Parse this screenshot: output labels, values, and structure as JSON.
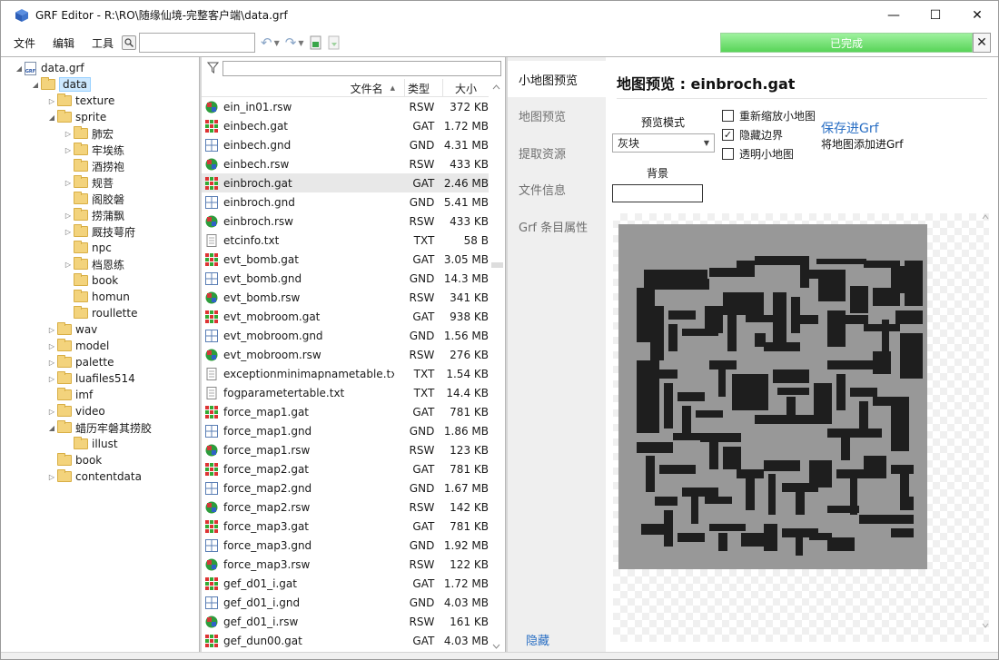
{
  "window": {
    "title": "GRF Editor - R:\\RO\\随缘仙境-完整客户端\\data.grf",
    "minimize_glyph": "—",
    "maximize_glyph": "☐",
    "close_glyph": "✕"
  },
  "menu": {
    "file": "文件",
    "edit": "编辑",
    "tools": "工具"
  },
  "toolbar": {
    "search_value": "",
    "undo_glyph": "↶",
    "redo_glyph": "↷",
    "progress_label": "已完成",
    "progress_fraction": 1.0,
    "progress_close": "✕"
  },
  "tree": {
    "root": "data.grf",
    "items": [
      {
        "label": "data",
        "depth": 1,
        "expanded": true,
        "selected": true
      },
      {
        "label": "texture",
        "depth": 2,
        "expanded": false
      },
      {
        "label": "sprite",
        "depth": 2,
        "expanded": true
      },
      {
        "label": "肺宏",
        "depth": 3,
        "expanded": false
      },
      {
        "label": "牢埃练",
        "depth": 3,
        "expanded": false
      },
      {
        "label": "酒捞袍",
        "depth": 3,
        "expanded": null
      },
      {
        "label": "规菩",
        "depth": 3,
        "expanded": false
      },
      {
        "label": "阁胶磐",
        "depth": 3,
        "expanded": null
      },
      {
        "label": "捞蒲飘",
        "depth": 3,
        "expanded": false
      },
      {
        "label": "厩技萼府",
        "depth": 3,
        "expanded": false
      },
      {
        "label": "npc",
        "depth": 3,
        "expanded": null
      },
      {
        "label": "档恩练",
        "depth": 3,
        "expanded": false
      },
      {
        "label": "book",
        "depth": 3,
        "expanded": null
      },
      {
        "label": "homun",
        "depth": 3,
        "expanded": null
      },
      {
        "label": "roullette",
        "depth": 3,
        "expanded": null
      },
      {
        "label": "wav",
        "depth": 2,
        "expanded": false
      },
      {
        "label": "model",
        "depth": 2,
        "expanded": false
      },
      {
        "label": "palette",
        "depth": 2,
        "expanded": false
      },
      {
        "label": "luafiles514",
        "depth": 2,
        "expanded": false
      },
      {
        "label": "imf",
        "depth": 2,
        "expanded": null
      },
      {
        "label": "video",
        "depth": 2,
        "expanded": false
      },
      {
        "label": "蜡历牢磐其捞胶",
        "depth": 2,
        "expanded": true
      },
      {
        "label": "illust",
        "depth": 3,
        "expanded": null
      },
      {
        "label": "book",
        "depth": 2,
        "expanded": null
      },
      {
        "label": "contentdata",
        "depth": 2,
        "expanded": false
      }
    ]
  },
  "filelist": {
    "filter_value": "",
    "columns": {
      "name": "文件名",
      "type": "类型",
      "size": "大小"
    },
    "rows": [
      {
        "name": "ein_in01.rsw",
        "type": "RSW",
        "size": "372 KB",
        "kind": "rsw"
      },
      {
        "name": "einbech.gat",
        "type": "GAT",
        "size": "1.72 MB",
        "kind": "gat"
      },
      {
        "name": "einbech.gnd",
        "type": "GND",
        "size": "4.31 MB",
        "kind": "gnd"
      },
      {
        "name": "einbech.rsw",
        "type": "RSW",
        "size": "433 KB",
        "kind": "rsw"
      },
      {
        "name": "einbroch.gat",
        "type": "GAT",
        "size": "2.46 MB",
        "kind": "gat",
        "selected": true
      },
      {
        "name": "einbroch.gnd",
        "type": "GND",
        "size": "5.41 MB",
        "kind": "gnd"
      },
      {
        "name": "einbroch.rsw",
        "type": "RSW",
        "size": "433 KB",
        "kind": "rsw"
      },
      {
        "name": "etcinfo.txt",
        "type": "TXT",
        "size": "58 B",
        "kind": "txt"
      },
      {
        "name": "evt_bomb.gat",
        "type": "GAT",
        "size": "3.05 MB",
        "kind": "gat"
      },
      {
        "name": "evt_bomb.gnd",
        "type": "GND",
        "size": "14.3 MB",
        "kind": "gnd"
      },
      {
        "name": "evt_bomb.rsw",
        "type": "RSW",
        "size": "341 KB",
        "kind": "rsw"
      },
      {
        "name": "evt_mobroom.gat",
        "type": "GAT",
        "size": "938 KB",
        "kind": "gat"
      },
      {
        "name": "evt_mobroom.gnd",
        "type": "GND",
        "size": "1.56 MB",
        "kind": "gnd"
      },
      {
        "name": "evt_mobroom.rsw",
        "type": "RSW",
        "size": "276 KB",
        "kind": "rsw"
      },
      {
        "name": "exceptionminimapnametable.txt",
        "type": "TXT",
        "size": "1.54 KB",
        "kind": "txt"
      },
      {
        "name": "fogparametertable.txt",
        "type": "TXT",
        "size": "14.4 KB",
        "kind": "txt"
      },
      {
        "name": "force_map1.gat",
        "type": "GAT",
        "size": "781 KB",
        "kind": "gat"
      },
      {
        "name": "force_map1.gnd",
        "type": "GND",
        "size": "1.86 MB",
        "kind": "gnd"
      },
      {
        "name": "force_map1.rsw",
        "type": "RSW",
        "size": "123 KB",
        "kind": "rsw"
      },
      {
        "name": "force_map2.gat",
        "type": "GAT",
        "size": "781 KB",
        "kind": "gat"
      },
      {
        "name": "force_map2.gnd",
        "type": "GND",
        "size": "1.67 MB",
        "kind": "gnd"
      },
      {
        "name": "force_map2.rsw",
        "type": "RSW",
        "size": "142 KB",
        "kind": "rsw"
      },
      {
        "name": "force_map3.gat",
        "type": "GAT",
        "size": "781 KB",
        "kind": "gat"
      },
      {
        "name": "force_map3.gnd",
        "type": "GND",
        "size": "1.92 MB",
        "kind": "gnd"
      },
      {
        "name": "force_map3.rsw",
        "type": "RSW",
        "size": "122 KB",
        "kind": "rsw"
      },
      {
        "name": "gef_d01_i.gat",
        "type": "GAT",
        "size": "1.72 MB",
        "kind": "gat"
      },
      {
        "name": "gef_d01_i.gnd",
        "type": "GND",
        "size": "4.03 MB",
        "kind": "gnd"
      },
      {
        "name": "gef_d01_i.rsw",
        "type": "RSW",
        "size": "161 KB",
        "kind": "rsw"
      },
      {
        "name": "gef_dun00.gat",
        "type": "GAT",
        "size": "4.03 MB",
        "kind": "gat"
      }
    ]
  },
  "tabs": {
    "items": [
      "小地图预览",
      "地图预览",
      "提取资源",
      "文件信息",
      "Grf 条目属性"
    ],
    "active": 0,
    "hide_link": "隐藏"
  },
  "minimap": {
    "title": "地图预览 : einbroch.gat",
    "mode_label": "预览模式",
    "mode_value": "灰块",
    "background_label": "背景",
    "checkbox_rescale": "重新缩放小地图",
    "checkbox_rescale_checked": false,
    "checkbox_hide_border": "隐藏边界",
    "checkbox_hide_border_checked": true,
    "checkbox_transparent": "透明小地图",
    "checkbox_transparent_checked": false,
    "save_link": "保存进Grf",
    "save_sub": "将地图添加进Grf",
    "map_background_color": "#989898",
    "map_wall_color": "#1e1e1e"
  }
}
